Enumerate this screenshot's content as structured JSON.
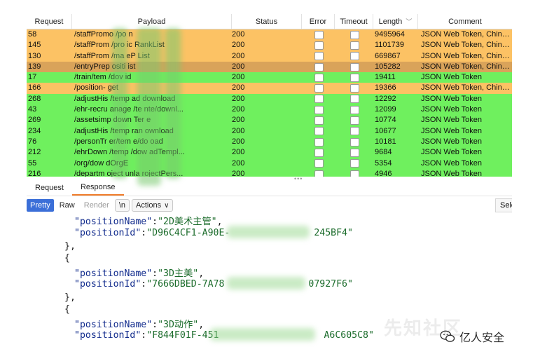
{
  "table": {
    "columns": [
      "Request",
      "Payload",
      "Status",
      "Error",
      "Timeout",
      "Length",
      "Comment"
    ],
    "rows": [
      {
        "request": "58",
        "payload": "/staffPromo       /po       n",
        "status": "200",
        "length": "9495964",
        "comment": "JSON Web Token, Chinese Ban...",
        "color": "orange"
      },
      {
        "request": "145",
        "payload": "/staffProm        /pro       ic    RankList",
        "status": "200",
        "length": "1101739",
        "comment": "JSON Web Token, Chinese Ban...",
        "color": "orange"
      },
      {
        "request": "130",
        "payload": "/staffProm        /ma      eP      List",
        "status": "200",
        "length": "669867",
        "comment": "JSON Web Token, Chinese Ban...",
        "color": "orange"
      },
      {
        "request": "139",
        "payload": "/entryPrep        ositi      ist",
        "status": "200",
        "length": "105282",
        "comment": "JSON Web Token, Chinese Ban...",
        "color": "dark"
      },
      {
        "request": "17",
        "payload": "/train/tem        /dov       id",
        "status": "200",
        "length": "19411",
        "comment": "JSON Web Token",
        "color": "green"
      },
      {
        "request": "166",
        "payload": "/position-        get",
        "status": "200",
        "length": "19366",
        "comment": "JSON Web Token, Chinese Ban...",
        "color": "orange"
      },
      {
        "request": "268",
        "payload": "/adjustHis        /temp      ad      download",
        "status": "200",
        "length": "12292",
        "comment": "JSON Web Token",
        "color": "green"
      },
      {
        "request": "43",
        "payload": "/ehr-recru        anage      /te    nte/downl...",
        "status": "200",
        "length": "12099",
        "comment": "JSON Web Token",
        "color": "green"
      },
      {
        "request": "269",
        "payload": "/assetsimp        down       Ter     e",
        "status": "200",
        "length": "10774",
        "comment": "JSON Web Token",
        "color": "green"
      },
      {
        "request": "234",
        "payload": "/adjustHis        /temp      ran    ownload",
        "status": "200",
        "length": "10677",
        "comment": "JSON Web Token",
        "color": "green"
      },
      {
        "request": "76",
        "payload": "/personTr         er/tem     e/do     oad",
        "status": "200",
        "length": "10181",
        "comment": "JSON Web Token",
        "color": "green"
      },
      {
        "request": "212",
        "payload": "/ehrDown          /temp      /dow    adTempl...",
        "status": "200",
        "length": "9684",
        "comment": "JSON Web Token",
        "color": "green"
      },
      {
        "request": "55",
        "payload": "/org/dow          dOrgE",
        "status": "200",
        "length": "5354",
        "comment": "JSON Web Token",
        "color": "green"
      },
      {
        "request": "216",
        "payload": "/departm          oject      unla    rojectPers...",
        "status": "200",
        "length": "4946",
        "comment": "JSON Web Token",
        "color": "green"
      }
    ]
  },
  "tabs": [
    "Request",
    "Response"
  ],
  "active_tab": "Response",
  "toolbar": {
    "pretty": "Pretty",
    "raw": "Raw",
    "render": "Render",
    "newline": "\\n",
    "actions": "Actions",
    "search": "Sele"
  },
  "code": {
    "l1_key": "\"positionName\"",
    "l1_val": "\"2D美术主管\"",
    "l2_key": "\"positionId\"",
    "l2_val_a": "\"D96C4CF1-A90E-",
    "l2_val_b": "245BF4\"",
    "l3": "},",
    "l4": "{",
    "l5_key": "\"positionName\"",
    "l5_val": "\"3D主美\"",
    "l6_key": "\"positionId\"",
    "l6_val_a": "\"7666DBED-7A78",
    "l6_val_b": "07927F6\"",
    "l7": "},",
    "l8": "{",
    "l9_key": "\"positionName\"",
    "l9_val": "\"3D动作\"",
    "l10_key": "\"positionId\"",
    "l10_val_a": "\"F844F01F-451",
    "l10_val_b": "A6C605C8\""
  },
  "watermark": {
    "faint": "先知社区",
    "brand": "亿人安全"
  },
  "colors": {
    "orange_row": "#fcc264",
    "dark_row": "#d9a35a",
    "green_row": "#6ff05e",
    "pretty_button": "#3b6fd8",
    "active_tab_underline": "#f07c2a"
  }
}
